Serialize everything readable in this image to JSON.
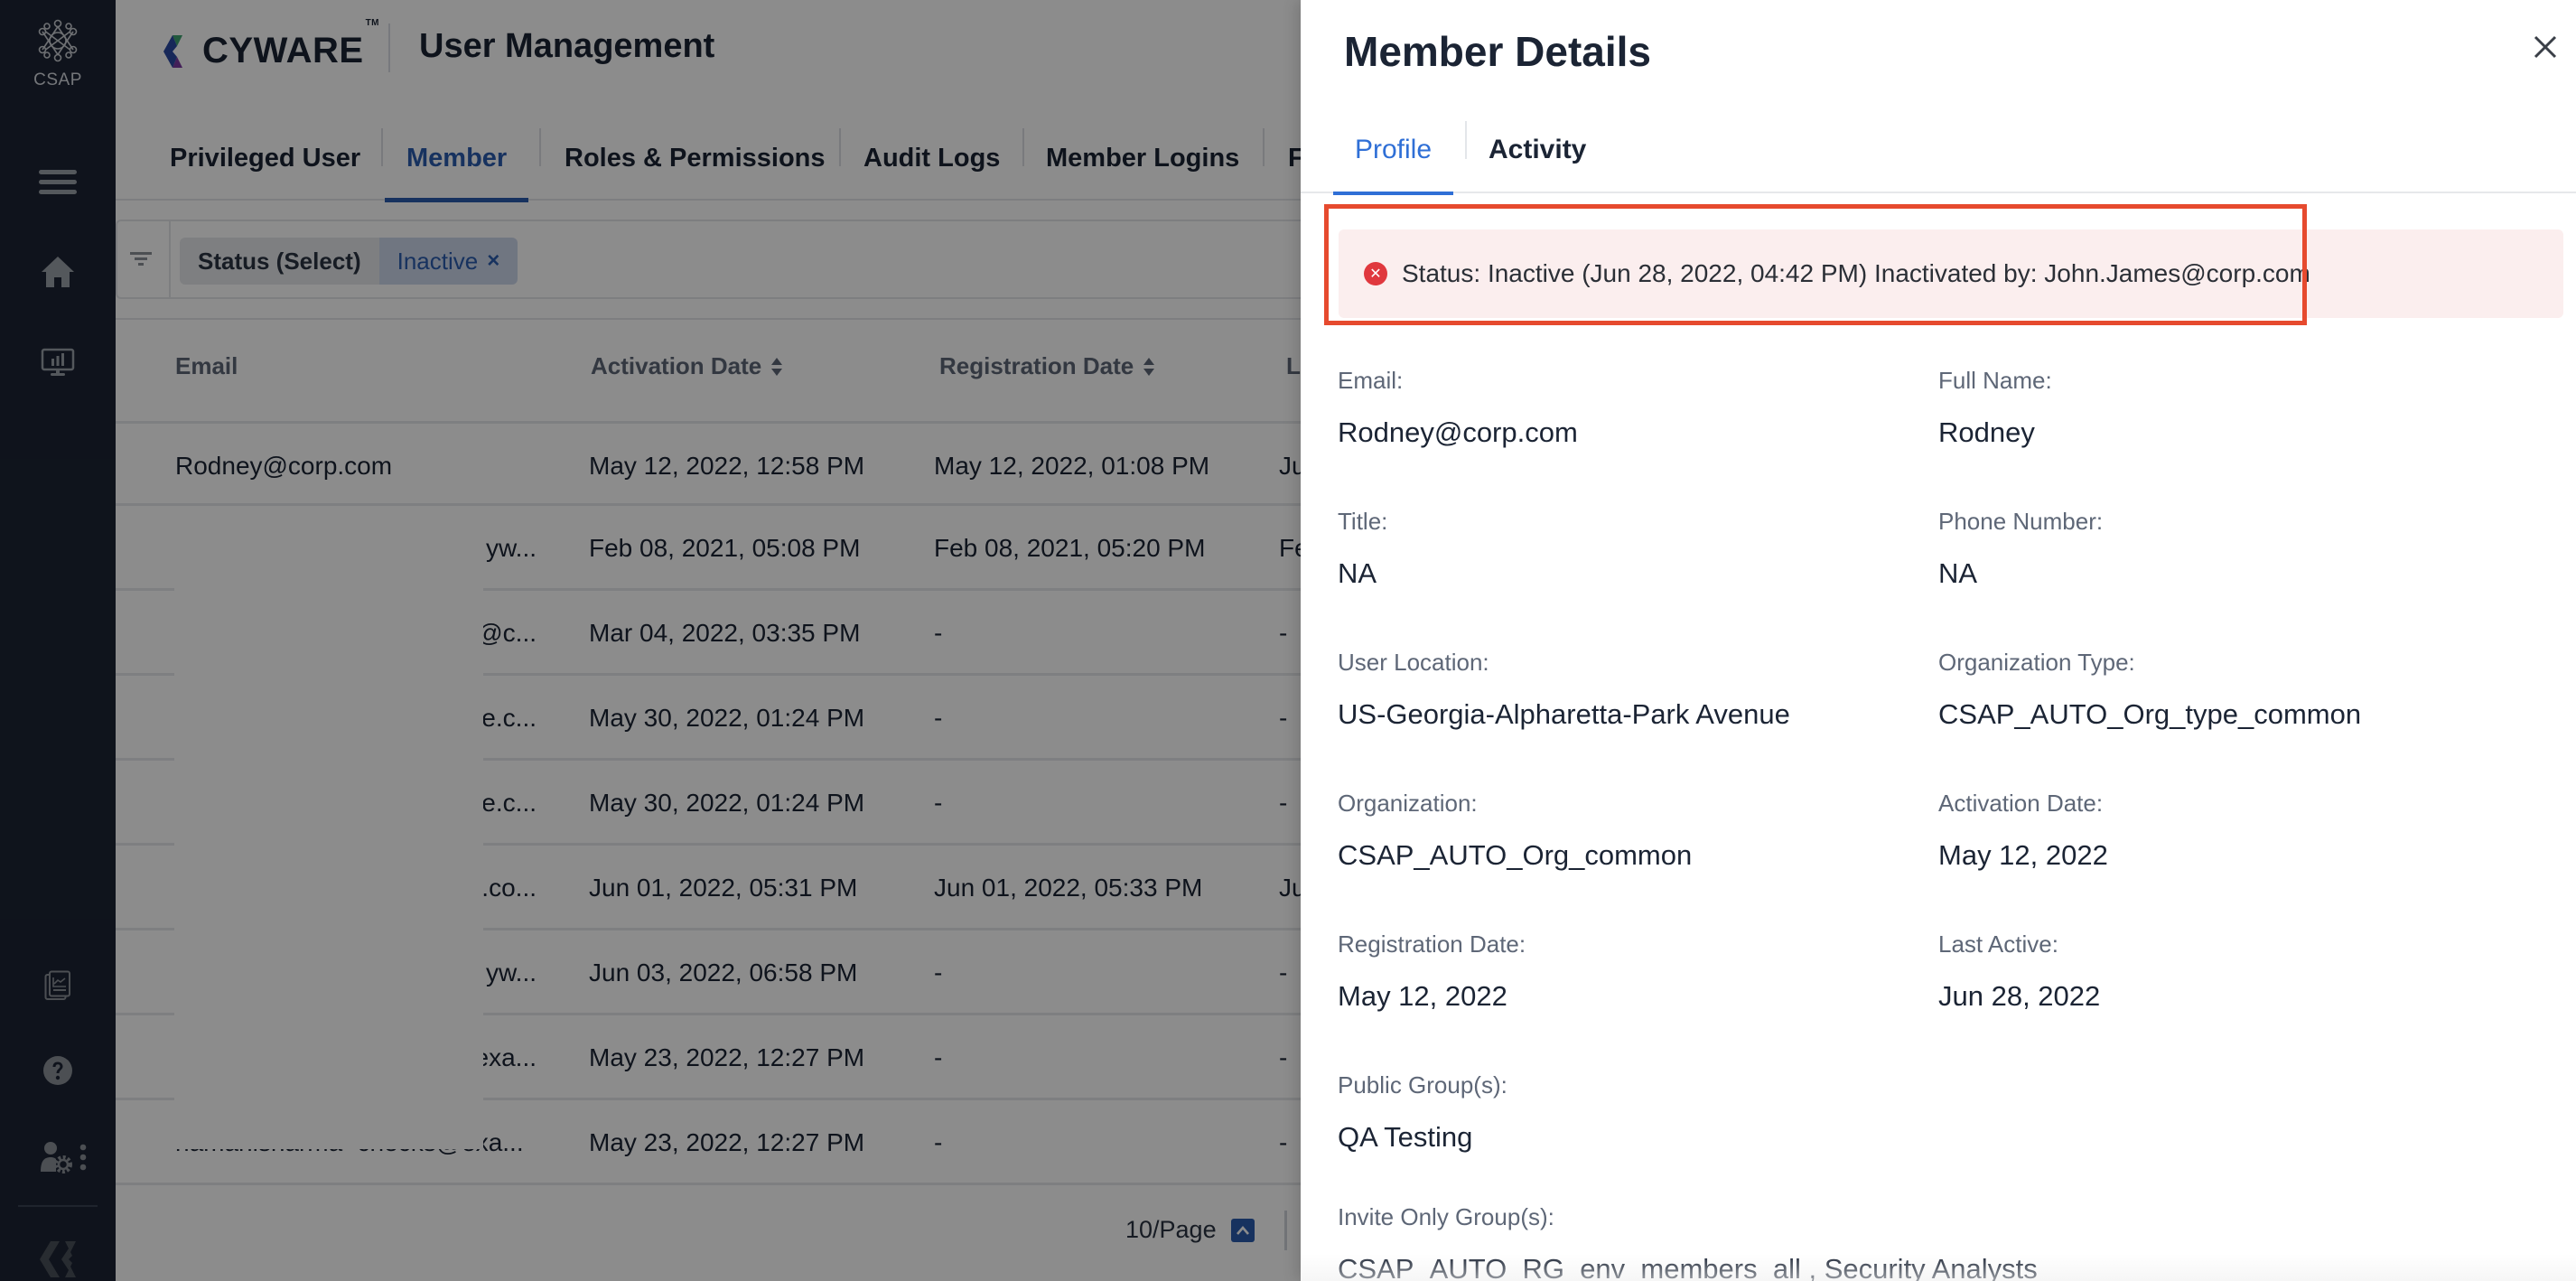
{
  "rail": {
    "brand_label": "CSAP",
    "items": [
      {
        "icon": "hamburger-menu-icon"
      },
      {
        "icon": "home-icon"
      },
      {
        "icon": "dashboard-monitor-icon"
      },
      {
        "icon": "reports-icon"
      },
      {
        "icon": "help-icon"
      },
      {
        "icon": "user-settings-icon"
      },
      {
        "icon": "more-vertical-icon"
      },
      {
        "icon": "cyware-logo-icon"
      }
    ]
  },
  "header": {
    "logo_text": "CYWARE",
    "logo_tm": "TM",
    "title": "User Management"
  },
  "main_tabs": [
    {
      "label": "Privileged User",
      "active": false
    },
    {
      "label": "Member",
      "active": true
    },
    {
      "label": "Roles & Permissions",
      "active": false
    },
    {
      "label": "Audit Logs",
      "active": false
    },
    {
      "label": "Member Logins",
      "active": false
    },
    {
      "label": "F",
      "active": false
    }
  ],
  "filter": {
    "key": "Status (Select)",
    "value": "Inactive",
    "remove_icon": "×"
  },
  "table": {
    "columns": [
      "Email",
      "Activation Date",
      "Registration Date",
      "L"
    ],
    "rows": [
      {
        "email": "Rodney@corp.com",
        "activation": "May 12, 2022, 12:58 PM",
        "registration": "May 12, 2022, 01:08 PM",
        "last": "Ju"
      },
      {
        "email": "yw...",
        "activation": "Feb 08, 2021, 05:08 PM",
        "registration": "Feb 08, 2021, 05:20 PM",
        "last": "Fe"
      },
      {
        "email": "l@c...",
        "activation": "Mar 04, 2022, 03:35 PM",
        "registration": "-",
        "last": "-"
      },
      {
        "email": "re.c...",
        "activation": "May 30, 2022, 01:24 PM",
        "registration": "-",
        "last": "-"
      },
      {
        "email": "re.c...",
        "activation": "May 30, 2022, 01:24 PM",
        "registration": "-",
        "last": "-"
      },
      {
        "email": "e.co...",
        "activation": "Jun 01, 2022, 05:31 PM",
        "registration": "Jun 01, 2022, 05:33 PM",
        "last": "Ju"
      },
      {
        "email": "yw...",
        "activation": "Jun 03, 2022, 06:58 PM",
        "registration": "-",
        "last": "-"
      },
      {
        "email": "exa...",
        "activation": "May 23, 2022, 12:27 PM",
        "registration": "-",
        "last": "-"
      },
      {
        "email": "namanisharma+checks@exa...",
        "activation": "May 23, 2022, 12:27 PM",
        "registration": "-",
        "last": "-"
      }
    ]
  },
  "pagination": {
    "page_size": "10/Page"
  },
  "drawer": {
    "title": "Member Details",
    "tabs": [
      {
        "label": "Profile",
        "active": true
      },
      {
        "label": "Activity",
        "active": false
      }
    ],
    "status_banner": "Status: Inactive (Jun 28, 2022, 04:42 PM) Inactivated by: John.James@corp.com",
    "fields": [
      {
        "label": "Email:",
        "value": "Rodney@corp.com"
      },
      {
        "label": "Full Name:",
        "value": "Rodney"
      },
      {
        "label": "Title:",
        "value": "NA"
      },
      {
        "label": "Phone Number:",
        "value": "NA"
      },
      {
        "label": "User Location:",
        "value": "US-Georgia-Alpharetta-Park Avenue"
      },
      {
        "label": "Organization Type:",
        "value": "CSAP_AUTO_Org_type_common"
      },
      {
        "label": "Organization:",
        "value": "CSAP_AUTO_Org_common"
      },
      {
        "label": "Activation Date:",
        "value": "May 12, 2022"
      },
      {
        "label": "Registration Date:",
        "value": "May 12, 2022"
      },
      {
        "label": "Last Active:",
        "value": "Jun 28, 2022"
      },
      {
        "label": "Public Group(s):",
        "value": "QA Testing"
      },
      {
        "label": "Invite Only Group(s):",
        "value": "CSAP_AUTO_RG_env_members_all , Security Analysts"
      }
    ]
  },
  "colors": {
    "accent": "#2a5cae",
    "drawer_accent": "#2f6fd6",
    "error": "#e0383e",
    "highlight": "#e64a2e",
    "rail_bg": "#1c2433"
  }
}
